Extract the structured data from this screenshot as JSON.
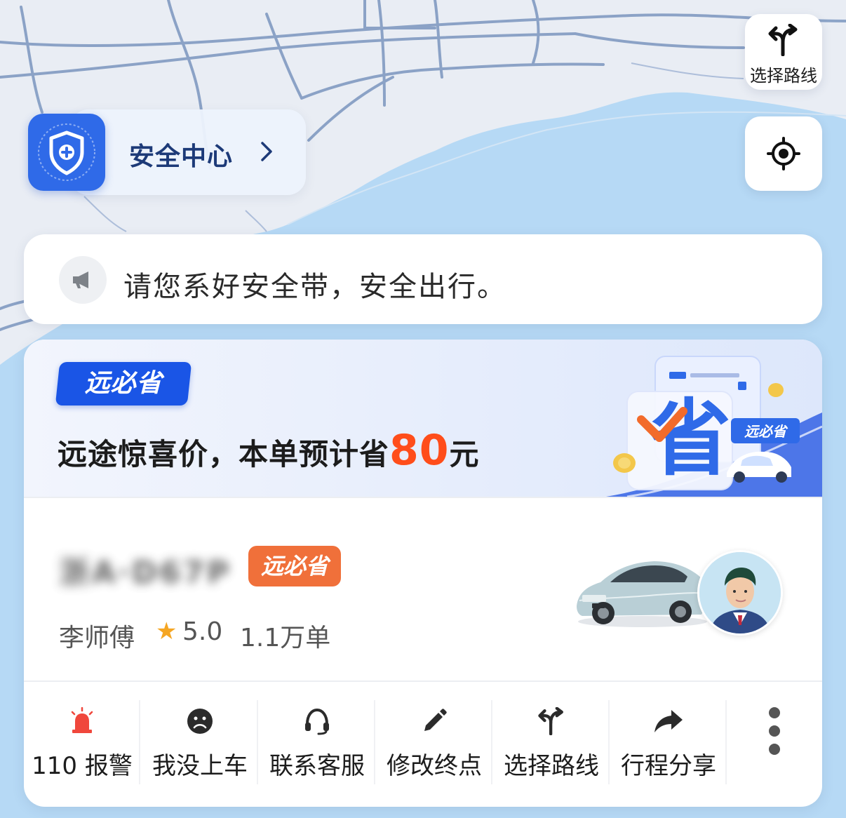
{
  "map": {
    "route_button_label": "选择路线",
    "route_icon": "route-fork-icon",
    "locate_icon": "locate-crosshair-icon",
    "water_color": "#b6d9f5",
    "land_color": "#e9edf4",
    "road_color": "#7b96bf"
  },
  "safety_center": {
    "label": "安全中心",
    "icon": "shield-plus-icon",
    "accent": "#2f6ae8"
  },
  "notice": {
    "icon": "megaphone-icon",
    "text": "请您系好安全带，安全出行。"
  },
  "promo": {
    "logo_text": "远必省",
    "title_prefix": "远途惊喜价，本单预计省",
    "amount": "80",
    "unit": "元",
    "art_tag": "远必省",
    "art_glyph": "省",
    "amount_color": "#ff4d1a",
    "logo_color": "#1a55e6"
  },
  "driver": {
    "plate": "浙A·D67P",
    "badge": "远必省",
    "name": "李师傅",
    "rating": "5.0",
    "orders": "1.1万单",
    "badge_color": "#f0703a"
  },
  "actions": [
    {
      "label": "110 报警",
      "icon": "alarm-light-icon"
    },
    {
      "label": "我没上车",
      "icon": "sad-face-icon"
    },
    {
      "label": "联系客服",
      "icon": "headset-icon"
    },
    {
      "label": "修改终点",
      "icon": "pencil-icon"
    },
    {
      "label": "选择路线",
      "icon": "route-fork-icon"
    },
    {
      "label": "行程分享",
      "icon": "share-arrow-icon"
    }
  ],
  "more_icon": "more-vertical-icon"
}
